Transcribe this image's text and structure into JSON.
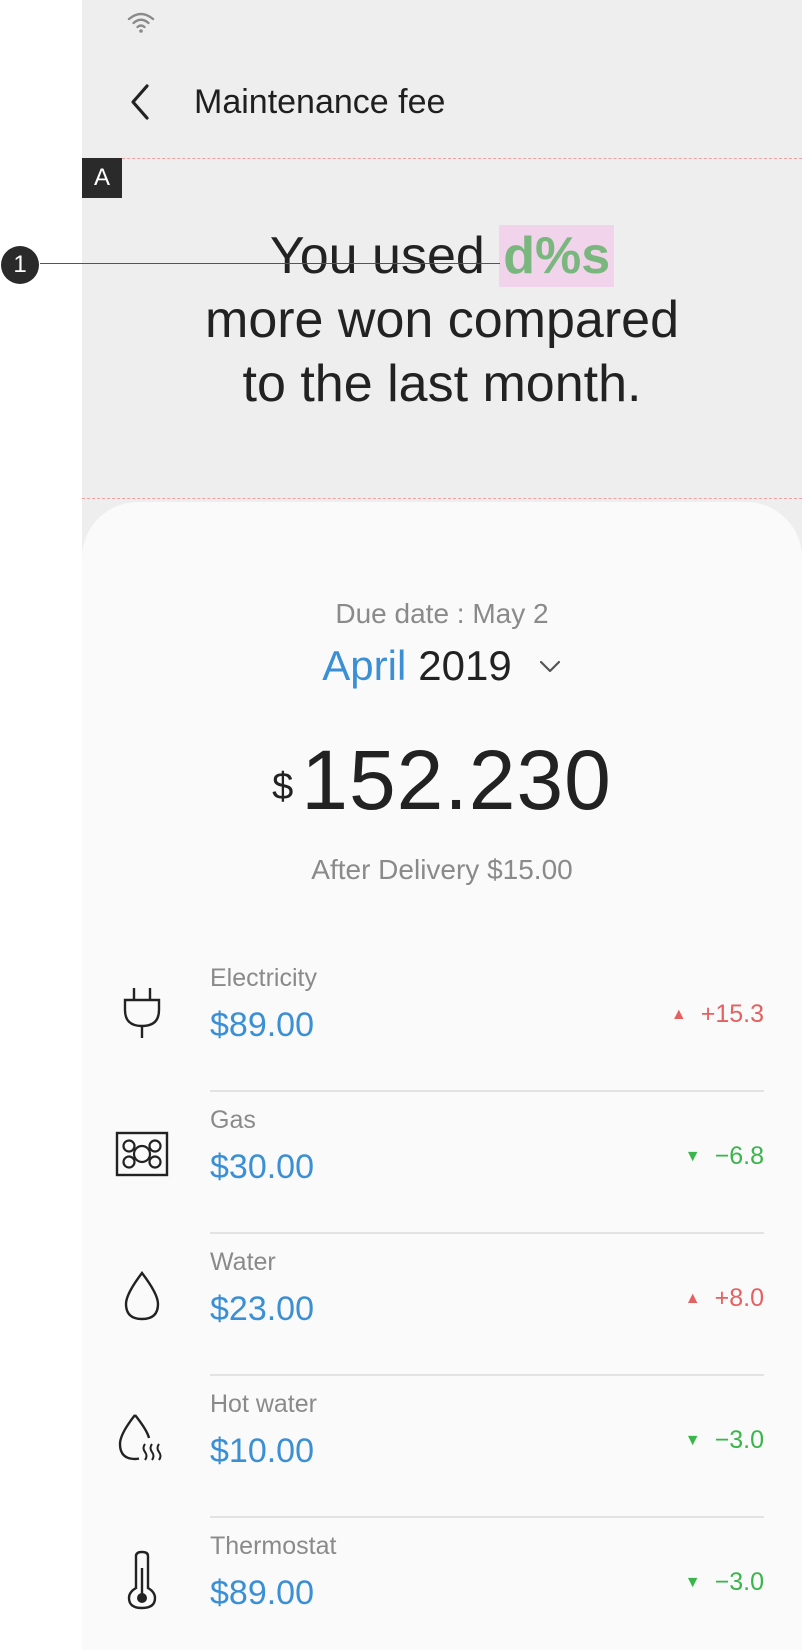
{
  "app": {
    "title": "Maintenance fee"
  },
  "annotations": {
    "section_marker": "A",
    "callout_number": "1"
  },
  "headline": {
    "prefix": "You used",
    "variable": "d%s",
    "line2": "more won compared",
    "line3": "to the last month."
  },
  "bill": {
    "due_date": "Due date : May 2",
    "month": "April",
    "year": "2019",
    "currency": "$",
    "total": "152.230",
    "after_delivery": "After Delivery $15.00"
  },
  "items": [
    {
      "icon": "plug-icon",
      "label": "Electricity",
      "value": "$89.00",
      "direction": "up",
      "indicator": "▲",
      "change": "+15.3"
    },
    {
      "icon": "stove-icon",
      "label": "Gas",
      "value": "$30.00",
      "direction": "down",
      "indicator": "▼",
      "change": "−6.8"
    },
    {
      "icon": "water-drop-icon",
      "label": "Water",
      "value": "$23.00",
      "direction": "up",
      "indicator": "▲",
      "change": "+8.0"
    },
    {
      "icon": "hot-water-icon",
      "label": "Hot water",
      "value": "$10.00",
      "direction": "down",
      "indicator": "▼",
      "change": "−3.0"
    },
    {
      "icon": "thermometer-icon",
      "label": "Thermostat",
      "value": "$89.00",
      "direction": "down",
      "indicator": "▼",
      "change": "−3.0"
    }
  ],
  "colors": {
    "accent_blue": "#3b8fd4",
    "increase_red": "#e66060",
    "decrease_green": "#39b54a",
    "highlight_bg": "#f1d4ec",
    "highlight_text": "#7ab77f"
  }
}
